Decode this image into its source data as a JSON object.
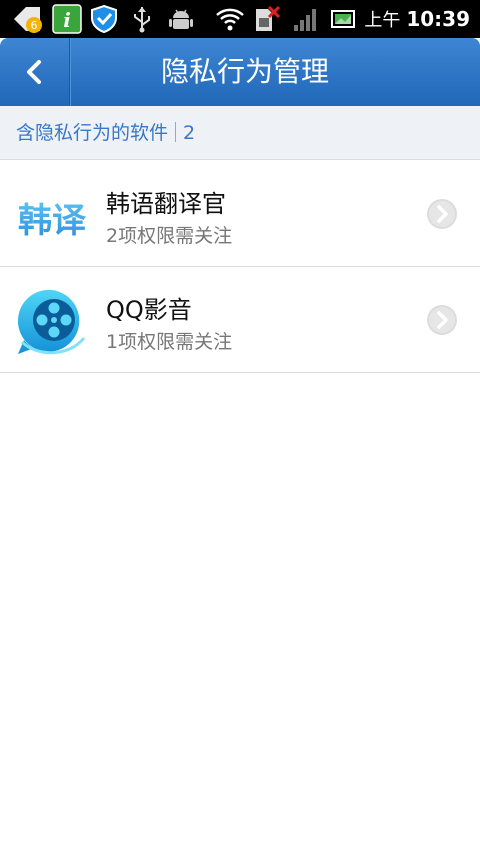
{
  "status_bar": {
    "badge_count": "6",
    "ampm": "上午",
    "time": "10:39"
  },
  "header": {
    "title": "隐私行为管理"
  },
  "subheader": {
    "label": "含隐私行为的软件",
    "count": "2"
  },
  "apps": [
    {
      "name": "韩语翻译官",
      "desc": "2项权限需关注",
      "icon": "korean-translator-icon",
      "icon_text": "韩译"
    },
    {
      "name": "QQ影音",
      "desc": "1项权限需关注",
      "icon": "qq-player-icon"
    }
  ],
  "colors": {
    "header": "#2a74c4",
    "accent": "#3a77c5"
  }
}
